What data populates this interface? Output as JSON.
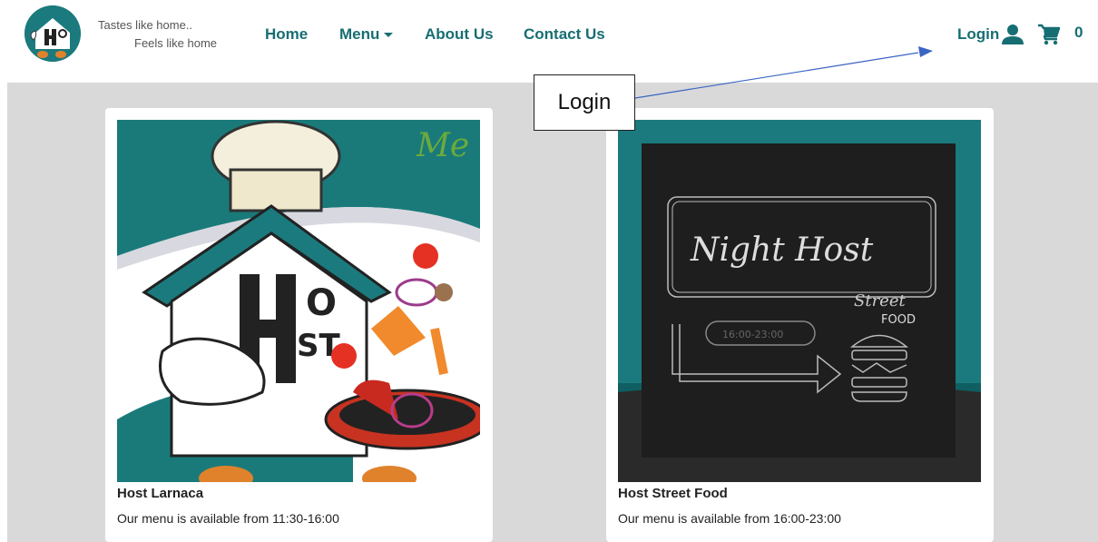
{
  "brand": {
    "tagline_line1": "Tastes like home..",
    "tagline_line2": "Feels like home"
  },
  "nav": [
    {
      "label": "Home"
    },
    {
      "label": "Menu"
    },
    {
      "label": "About Us"
    },
    {
      "label": "Contact Us"
    }
  ],
  "header_right": {
    "login_label": "Login",
    "cart_count": "0"
  },
  "cards": [
    {
      "title": "Host Larnaca",
      "text": "Our menu is available from 11:30-16:00"
    },
    {
      "title": "Host Street Food",
      "text": "Our menu is available from 16:00-23:00",
      "image_text": {
        "line1": "Night Host",
        "line2": "Street",
        "line3": "FOOD",
        "hours": "16:00-23:00"
      }
    }
  ],
  "annotation": {
    "label": "Login"
  },
  "colors": {
    "accent": "#176e72",
    "teal": "#1b7a7d",
    "content_bg": "#d9d9d9",
    "arrow": "#3b64c4"
  }
}
